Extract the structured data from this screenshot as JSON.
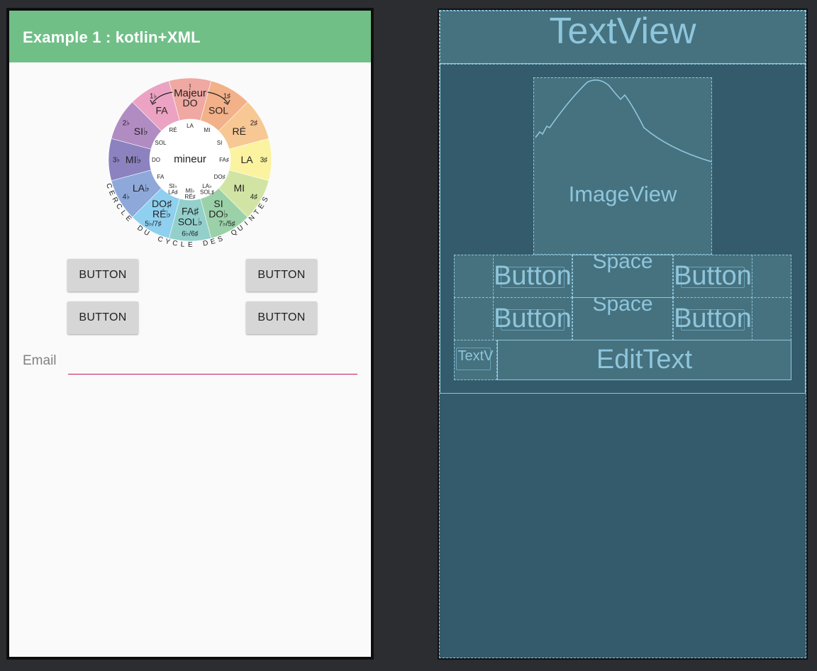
{
  "app": {
    "title": "Example 1 : kotlin+XML",
    "appbar_color": "#70bf87"
  },
  "wheel": {
    "outer_ring": [
      {
        "label": "DO",
        "color": "#f0a8a2"
      },
      {
        "label": "SOL",
        "color": "#f2b189"
      },
      {
        "label": "RÉ",
        "color": "#f7c794"
      },
      {
        "label": "LA",
        "color": "#fbf3a0"
      },
      {
        "label": "MI",
        "color": "#d2e4a4"
      },
      {
        "label": "SI\nDO♭",
        "color": "#9bd1a8"
      },
      {
        "label": "FA♯\nSOL♭",
        "color": "#93d0cc"
      },
      {
        "label": "DO♯\nRÉ♭",
        "color": "#8fcfef"
      },
      {
        "label": "LA♭",
        "color": "#8ea8da"
      },
      {
        "label": "MI♭",
        "color": "#8b82bf"
      },
      {
        "label": "SI♭",
        "color": "#b18cc2"
      },
      {
        "label": "FA",
        "color": "#eca3c3"
      }
    ],
    "accidentals": [
      "♮",
      "1♯",
      "2♯",
      "3♯",
      "4♯",
      "7♭/5♯",
      "6♭/6♯",
      "5♭/7♯",
      "4♭",
      "3♭",
      "2♭",
      "1♭"
    ],
    "inner_ring": [
      "LA",
      "MI",
      "SI",
      "FA♯",
      "DO♯",
      "LA♭\nSOL♯",
      "MI♭\nRÉ♯",
      "SI♭\nLA♯",
      "FA",
      "DO",
      "SOL",
      "RÉ"
    ],
    "major_label": "Majeur",
    "minor_label": "mineur",
    "caption": "CERCLE DU CYCLE DES QUINTES"
  },
  "buttons": {
    "top_left": "BUTTON",
    "top_right": "BUTTON",
    "bottom_left": "BUTTON",
    "bottom_right": "BUTTON"
  },
  "email": {
    "label": "Email",
    "value": "",
    "accent_color": "#c2185b"
  },
  "blueprint": {
    "textview": "TextView",
    "imageview": "ImageView",
    "button_label": "Button",
    "space_label": "Space",
    "small_textview": "TextV",
    "edittext": "EditText",
    "line_color": "#8ec6dc",
    "background_color": "#335b6b"
  }
}
